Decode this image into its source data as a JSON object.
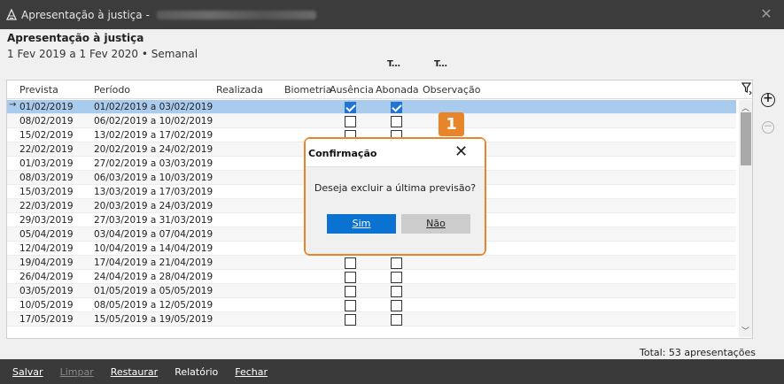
{
  "window": {
    "title": "Apresentação à justiça -",
    "close_glyph": "✕"
  },
  "header": {
    "title": "Apresentação à justiça",
    "subtitle": "1 Fev 2019 a 1 Fev 2020 • Semanal",
    "mini_col_1": "T...",
    "mini_col_2": "T..."
  },
  "grid": {
    "columns": [
      "Prevista",
      "Período",
      "Realizada",
      "Biometria",
      "Ausência",
      "Abonada",
      "Observação"
    ],
    "rows": [
      {
        "prevista": "01/02/2019",
        "periodo": "01/02/2019 a 03/02/2019",
        "ausencia": true,
        "abonada": true,
        "selected": true
      },
      {
        "prevista": "08/02/2019",
        "periodo": "06/02/2019 a 10/02/2019",
        "ausencia": false,
        "abonada": false
      },
      {
        "prevista": "15/02/2019",
        "periodo": "13/02/2019 a 17/02/2019",
        "ausencia": false,
        "abonada": false
      },
      {
        "prevista": "22/02/2019",
        "periodo": "20/02/2019 a 24/02/2019",
        "ausencia": false,
        "abonada": false
      },
      {
        "prevista": "01/03/2019",
        "periodo": "27/02/2019 a 03/03/2019",
        "ausencia": false,
        "abonada": false
      },
      {
        "prevista": "08/03/2019",
        "periodo": "06/03/2019 a 10/03/2019",
        "ausencia": false,
        "abonada": false
      },
      {
        "prevista": "15/03/2019",
        "periodo": "13/03/2019 a 17/03/2019",
        "ausencia": false,
        "abonada": false
      },
      {
        "prevista": "22/03/2019",
        "periodo": "20/03/2019 a 24/03/2019",
        "ausencia": false,
        "abonada": false
      },
      {
        "prevista": "29/03/2019",
        "periodo": "27/03/2019 a 31/03/2019",
        "ausencia": false,
        "abonada": false
      },
      {
        "prevista": "05/04/2019",
        "periodo": "03/04/2019 a 07/04/2019",
        "ausencia": false,
        "abonada": false
      },
      {
        "prevista": "12/04/2019",
        "periodo": "10/04/2019 a 14/04/2019",
        "ausencia": false,
        "abonada": false
      },
      {
        "prevista": "19/04/2019",
        "periodo": "17/04/2019 a 21/04/2019",
        "ausencia": false,
        "abonada": false
      },
      {
        "prevista": "26/04/2019",
        "periodo": "24/04/2019 a 28/04/2019",
        "ausencia": false,
        "abonada": false
      },
      {
        "prevista": "03/05/2019",
        "periodo": "01/05/2019 a 05/05/2019",
        "ausencia": false,
        "abonada": false
      },
      {
        "prevista": "10/05/2019",
        "periodo": "08/05/2019 a 12/05/2019",
        "ausencia": false,
        "abonada": false
      },
      {
        "prevista": "17/05/2019",
        "periodo": "15/05/2019 a 19/05/2019",
        "ausencia": false,
        "abonada": false
      }
    ],
    "total": "Total: 53 apresentações"
  },
  "dialog": {
    "title": "Confirmação",
    "message": "Deseja excluir a última previsão?",
    "yes_label": "Sim",
    "no_label": "Não",
    "close_glyph": "✕"
  },
  "badge": "1",
  "toolbar": {
    "salvar": "Salvar",
    "limpar": "Limpar",
    "restaurar": "Restaurar",
    "relatorio": "Relatório",
    "fechar": "Fechar"
  },
  "colors": {
    "accent": "#0a73d2",
    "selection": "#a9cbee",
    "highlight": "#e8852b"
  }
}
